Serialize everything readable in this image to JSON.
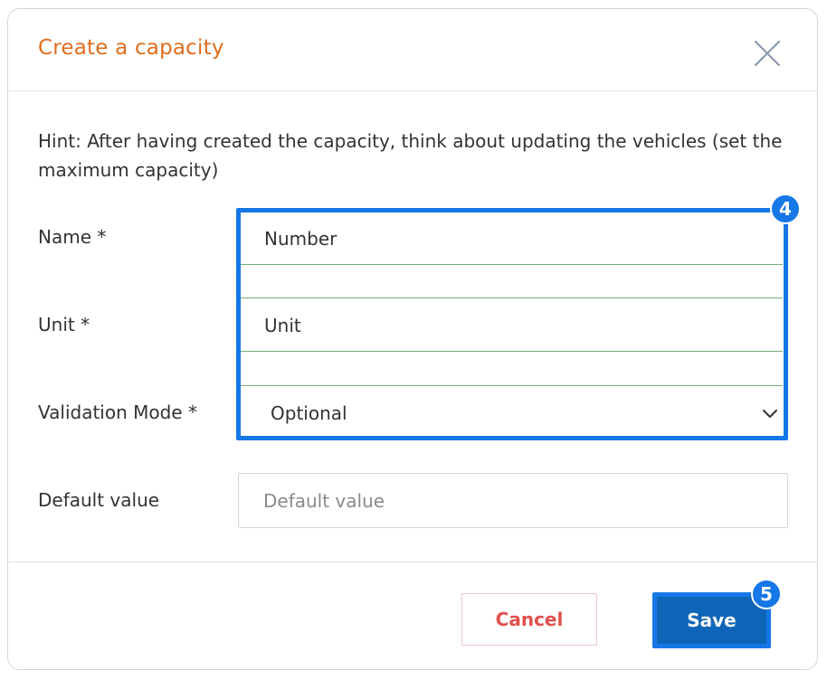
{
  "dialog": {
    "title": "Create a capacity",
    "hint": "Hint: After having created the capacity, think about updating the vehicles (set the maximum capacity)"
  },
  "form": {
    "name": {
      "label": "Name *",
      "value": "Number"
    },
    "unit": {
      "label": "Unit *",
      "value": "Unit"
    },
    "validation_mode": {
      "label": "Validation Mode *",
      "selected": "Optional"
    },
    "default_value": {
      "label": "Default value",
      "value": "",
      "placeholder": "Default value"
    }
  },
  "annotations": {
    "fields_badge": "4",
    "save_badge": "5"
  },
  "footer": {
    "cancel_label": "Cancel",
    "save_label": "Save"
  },
  "colors": {
    "title": "#e06c1f",
    "highlight": "#1677e6",
    "save_bg": "#0f66b8",
    "cancel_text": "#e0514d",
    "input_underline": "#6fb36f"
  },
  "icons": {
    "close": "close-icon",
    "dropdown": "chevron-down-icon"
  }
}
